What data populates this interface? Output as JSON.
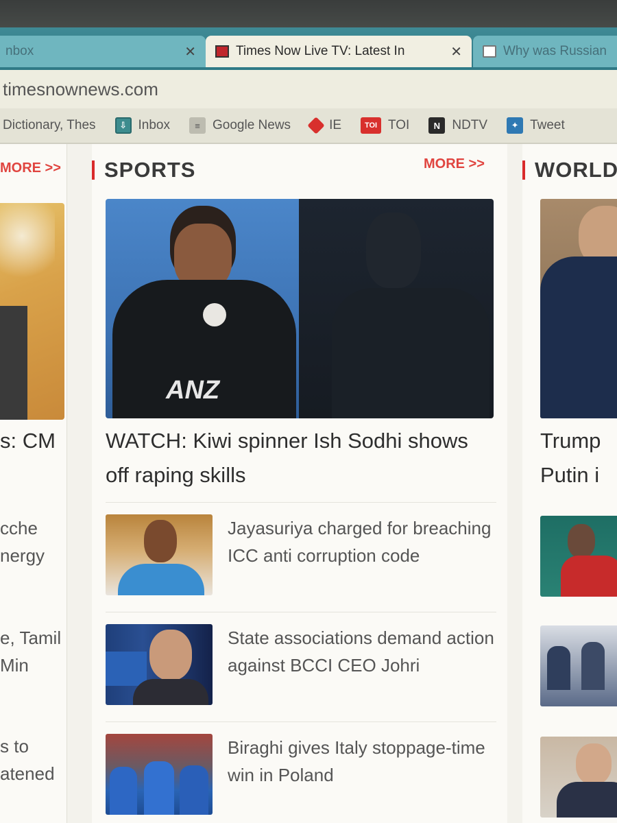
{
  "browser": {
    "tabs": [
      {
        "label": "nbox"
      },
      {
        "label": "Times Now Live TV: Latest In"
      },
      {
        "label": "Why was Russian"
      }
    ],
    "url": "timesnownews.com",
    "bookmarks": [
      {
        "label": "Dictionary, Thes"
      },
      {
        "label": "Inbox",
        "icon": "inbox-icon"
      },
      {
        "label": "Google News",
        "icon": "google-news-icon"
      },
      {
        "label": "IE",
        "icon": "ie-icon"
      },
      {
        "label": "TOI",
        "icon": "toi-icon",
        "badge": "TOI"
      },
      {
        "label": "NDTV",
        "icon": "ndtv-icon",
        "badge": "N"
      },
      {
        "label": "Tweet",
        "icon": "tweetdeck-icon"
      }
    ]
  },
  "left_column": {
    "more_label": "MORE >>",
    "headline_fragment": "s: CM",
    "items": [
      {
        "line1": "cche",
        "line2": "nergy"
      },
      {
        "line1": "e, Tamil",
        "line2": "Min"
      },
      {
        "line1": "s to",
        "line2": "atened"
      }
    ]
  },
  "sports": {
    "title": "SPORTS",
    "more_label": "MORE >>",
    "lead_headline": "WATCH: Kiwi spinner Ish Sodhi shows off raping skills",
    "hero_brand": "ANZ",
    "items": [
      {
        "title": "Jayasuriya charged for breaching ICC anti corruption code"
      },
      {
        "title": "State associations demand action against BCCI CEO Johri"
      },
      {
        "title": "Biraghi gives Italy stoppage-time win in Poland"
      }
    ]
  },
  "world": {
    "title": "WORLD",
    "lead_line1": "Trump",
    "lead_line2": "Putin i"
  },
  "colors": {
    "accent_red": "#d92b2b",
    "more_red": "#e0443f",
    "tab_teal": "#3f8a95"
  }
}
